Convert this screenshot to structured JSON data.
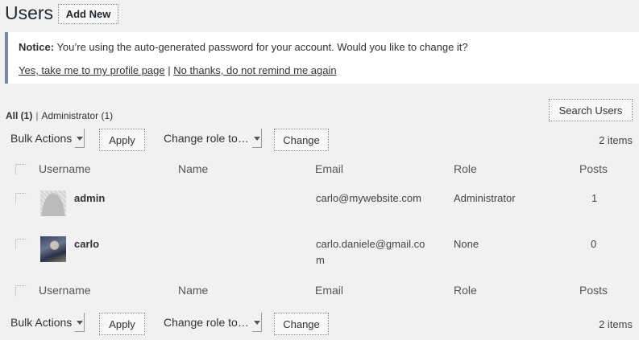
{
  "header": {
    "title": "Users",
    "add_new_label": "Add New"
  },
  "notice": {
    "label": "Notice:",
    "message": " You’re using the auto-generated password for your account. Would you like to change it?",
    "link_yes": "Yes, take me to my profile page",
    "separator": "|",
    "link_no": "No thanks, do not remind me again"
  },
  "filters": {
    "all": "All (1)",
    "separator": "|",
    "administrator": "Administrator (1)"
  },
  "search": {
    "button_label": "Search Users"
  },
  "toolbar": {
    "bulk_actions": "Bulk Actions",
    "apply": "Apply",
    "change_role": "Change role to…",
    "change": "Change",
    "items_count": "2 items"
  },
  "table": {
    "columns": [
      "Username",
      "Name",
      "Email",
      "Role",
      "Posts"
    ],
    "rows": [
      {
        "username": "admin",
        "name": "",
        "email": "carlo@mywebsite.com",
        "email_line2": "",
        "role": "Administrator",
        "posts": "1"
      },
      {
        "username": "carlo",
        "name": "",
        "email": "carlo.daniele@gmail.co",
        "email_line2": "m",
        "role": "None",
        "posts": "0"
      }
    ]
  }
}
